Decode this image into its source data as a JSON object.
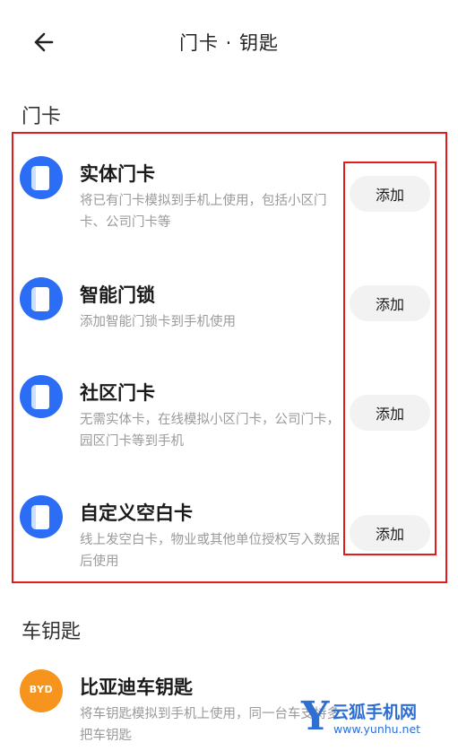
{
  "header": {
    "title": "门卡 · 钥匙"
  },
  "sections": {
    "door_cards": "门卡",
    "car_keys": "车钥匙"
  },
  "door_card_items": [
    {
      "name": "实体门卡",
      "desc": "将已有门卡模拟到手机上使用，包括小区门卡、公司门卡等",
      "button": "添加"
    },
    {
      "name": "智能门锁",
      "desc": "添加智能门锁卡到手机使用",
      "button": "添加"
    },
    {
      "name": "社区门卡",
      "desc": "无需实体卡，在线模拟小区门卡，公司门卡，园区门卡等到手机",
      "button": "添加"
    },
    {
      "name": "自定义空白卡",
      "desc": "线上发空白卡，物业或其他单位授权写入数据后使用",
      "button": "添加"
    }
  ],
  "car_key_items": [
    {
      "name": "比亚迪车钥匙",
      "desc": "将车钥匙模拟到手机上使用，同一台车支持多把车钥匙",
      "logo_text": "BYD"
    }
  ],
  "icons": {
    "back": "arrow-left-icon",
    "door_card": "card-icon",
    "byd": "byd-logo-icon"
  },
  "colors": {
    "accent": "#2c6df6",
    "byd": "#f7941e",
    "highlight": "#e11c1c",
    "button_bg": "#f2f2f2"
  },
  "watermark": {
    "letter": "Y",
    "name": "云狐手机网",
    "url": "www.yunhu.net"
  }
}
